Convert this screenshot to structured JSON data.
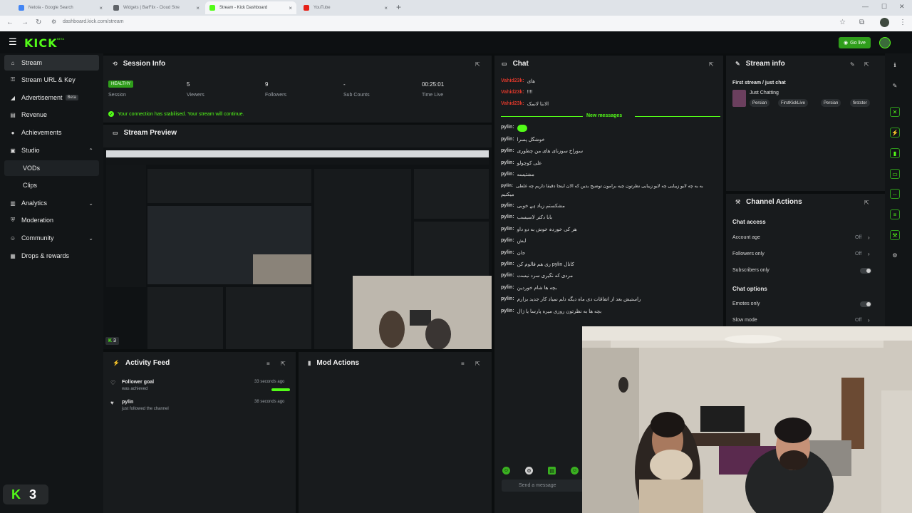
{
  "browser": {
    "tabs": [
      {
        "label": "Netola - Google Search"
      },
      {
        "label": "Widgets | BarFlix - Cloud Stre"
      },
      {
        "label": "Stream - Kick Dashboard"
      },
      {
        "label": "YouTube"
      }
    ],
    "url": "dashboard.kick.com/stream"
  },
  "app": {
    "logo": "KICK",
    "logo_sup": "BETA",
    "go_live": "Go live"
  },
  "sidebar": {
    "items": [
      {
        "label": "Stream"
      },
      {
        "label": "Stream URL & Key"
      },
      {
        "label": "Advertisement",
        "badge": "Beta"
      },
      {
        "label": "Revenue"
      },
      {
        "label": "Achievements"
      },
      {
        "label": "Studio"
      },
      {
        "label": "VODs"
      },
      {
        "label": "Clips"
      },
      {
        "label": "Analytics"
      },
      {
        "label": "Moderation"
      },
      {
        "label": "Community"
      },
      {
        "label": "Drops & rewards"
      }
    ],
    "badge_count": "3"
  },
  "session": {
    "title": "Session Info",
    "status": "HEALTHY",
    "status_label": "Session",
    "viewers": "5",
    "viewers_label": "Viewers",
    "followers": "9",
    "followers_label": "Followers",
    "subs": "-",
    "subs_label": "Sub Counts",
    "time": "00:25:01",
    "time_label": "Time Live",
    "connection_msg": "Your connection has stabilised. Your stream will continue."
  },
  "preview": {
    "title": "Stream Preview",
    "viewer_badge": "3"
  },
  "activity": {
    "title": "Activity Feed",
    "items": [
      {
        "title": "Follower goal",
        "sub": "was achieved",
        "time": "33 seconds ago"
      },
      {
        "title": "pylin",
        "sub": "just followed the channel",
        "time": "38 seconds ago"
      }
    ]
  },
  "mod": {
    "title": "Mod Actions"
  },
  "chat": {
    "title": "Chat",
    "old_messages": [
      {
        "user": "Vahid23k:",
        "text": "های"
      },
      {
        "user": "Vahid23k:",
        "text": "!!!!"
      },
      {
        "user": "Vahid23k:",
        "text": "الانتا لانمک"
      }
    ],
    "new_label": "New messages",
    "messages": [
      {
        "user": "pylin:",
        "text": ""
      },
      {
        "user": "pylin:",
        "text": "خوشگل پسرا"
      },
      {
        "user": "pylin:",
        "text": "سوراخ سوزنای های من چطوری"
      },
      {
        "user": "pylin:",
        "text": "علی کوچولو"
      },
      {
        "user": "pylin:",
        "text": "مشتیسه"
      },
      {
        "user": "pylin:",
        "text": "به به چه لایو زیبایی چه لایو زیبایی نظرتون چیه برامون توضیح بدین که الان اینجا دقیقا داریم چه غلطی"
      },
      {
        "user": "",
        "text": "میکنیم"
      },
      {
        "user": "pylin:",
        "text": "مشکستم زیاد ہے خوبی"
      },
      {
        "user": "pylin:",
        "text": "بابا دکتر لاسیسب"
      },
      {
        "user": "pylin:",
        "text": "هر کی خوردہ خوش به دو داو"
      },
      {
        "user": "pylin:",
        "text": "ایش"
      },
      {
        "user": "pylin:",
        "text": "جان"
      },
      {
        "user": "pylin:",
        "text": "ری هم فالوم کن pylin کانال"
      },
      {
        "user": "pylin:",
        "text": "مردی که نگیری سرد نیست"
      },
      {
        "user": "pylin:",
        "text": "بچه ها شام خوردین"
      },
      {
        "user": "pylin:",
        "text": "راستیش بعد از اتفاقات دی ماه دیگه دلم نمیاد کار جدید بزارم"
      },
      {
        "user": "pylin:",
        "text": "بچه ها به نظرتون روزی میره پارسا یا ژال"
      }
    ],
    "input_placeholder": "Send a message"
  },
  "stream_info": {
    "title": "Stream info",
    "stream_title": "First stream / just chat",
    "category": "Just Chatting",
    "tags": [
      "Persian",
      "FirstKickLive",
      "Persian",
      "firstster"
    ]
  },
  "channel_actions": {
    "title": "Channel Actions",
    "chat_access": "Chat access",
    "rows1": [
      {
        "label": "Account age",
        "value": "Off"
      },
      {
        "label": "Followers only",
        "value": "Off"
      },
      {
        "label": "Subscribers only",
        "value": ""
      }
    ],
    "chat_options": "Chat options",
    "rows2": [
      {
        "label": "Emotes only",
        "value": ""
      },
      {
        "label": "Slow mode",
        "value": "Off"
      }
    ]
  },
  "colors": {
    "accent": "#53fc18",
    "danger": "#d9372a",
    "panel": "#181b1d"
  }
}
